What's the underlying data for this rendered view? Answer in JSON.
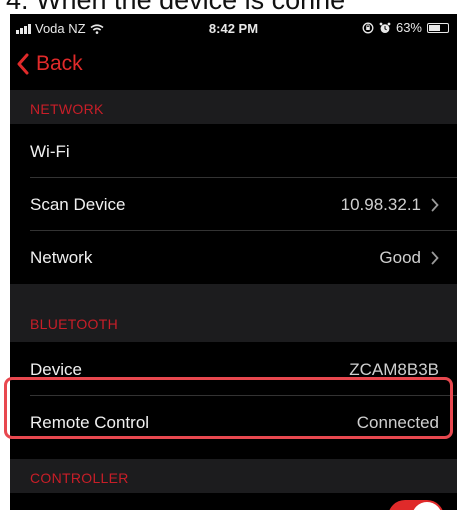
{
  "caption": {
    "text": "4. When the device is conne"
  },
  "status_bar": {
    "carrier": "Voda NZ",
    "time": "8:42 PM",
    "battery": "63%",
    "battery_level": 0.63
  },
  "nav": {
    "back_label": "Back"
  },
  "sections": {
    "network": {
      "header": "NETWORK",
      "rows": [
        {
          "label": "Wi-Fi",
          "value": ""
        },
        {
          "label": "Scan Device",
          "value": "10.98.32.1"
        },
        {
          "label": "Network",
          "value": "Good"
        }
      ]
    },
    "bluetooth": {
      "header": "BLUETOOTH",
      "rows": [
        {
          "label": "Device",
          "value": "ZCAM8B3B"
        },
        {
          "label": "Remote Control",
          "value": "Connected"
        }
      ]
    },
    "controller": {
      "header": "CONTROLLER",
      "toggle_on": true
    }
  },
  "colors": {
    "accent": "#e02a2a",
    "section_header_text": "#c81e28",
    "highlight_border": "#e8484f"
  }
}
